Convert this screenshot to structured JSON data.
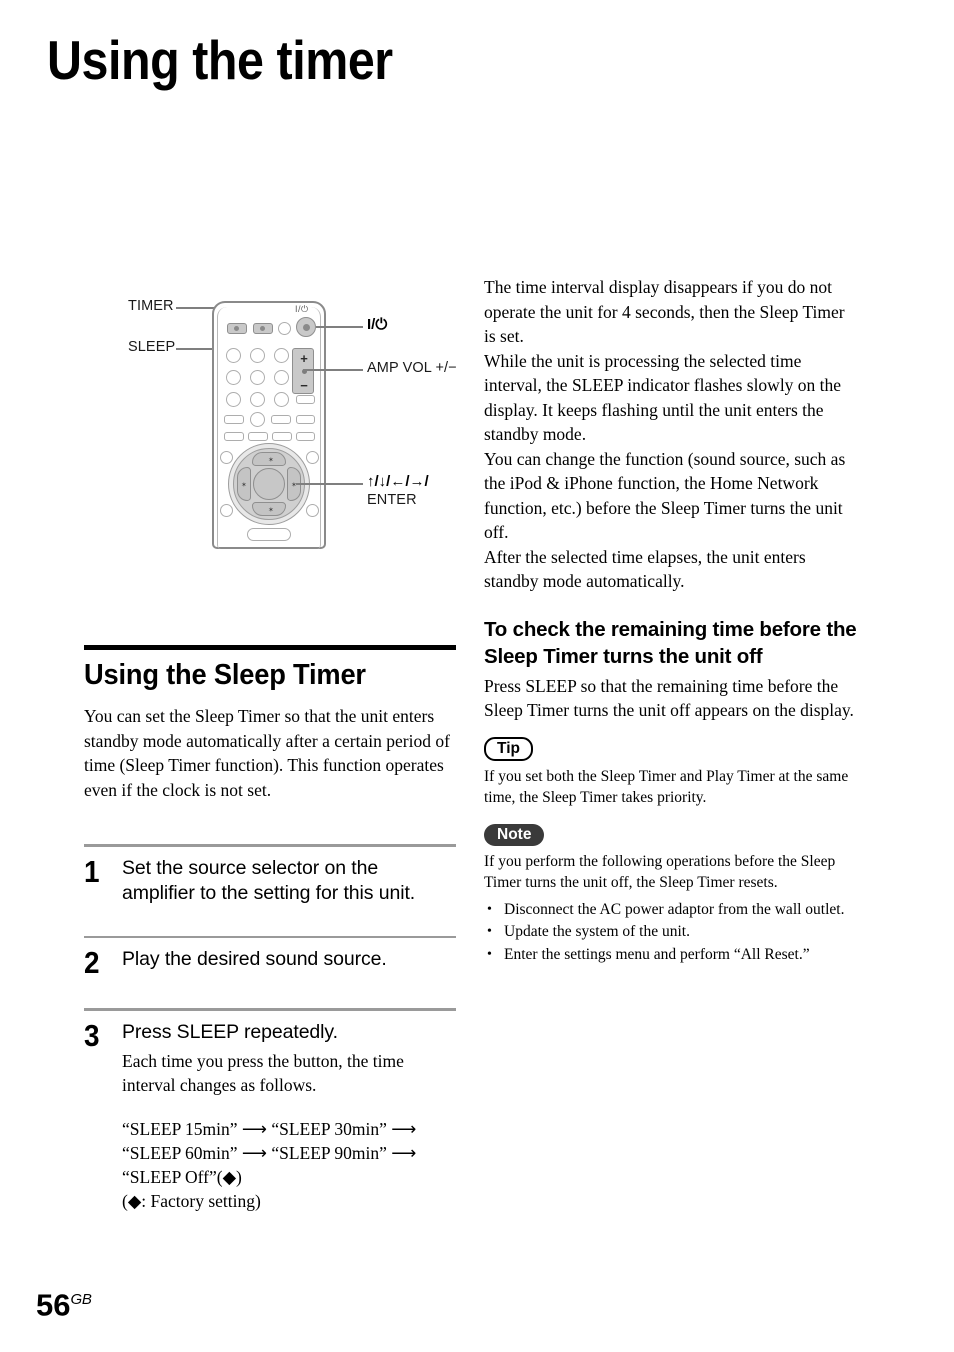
{
  "page": {
    "title": "Using the timer",
    "number": "56",
    "number_suffix": "GB"
  },
  "figure": {
    "name": "remote-control-diagram",
    "callouts": {
      "timer": "TIMER",
      "sleep": "SLEEP",
      "power": "I/⏻",
      "amp_vol": "AMP VOL +/−",
      "dpad_arrows": "↑/↓/←/→/",
      "dpad_enter": "ENTER"
    },
    "dpad_segment_glyph": "✦"
  },
  "left_column": {
    "section_heading": "Using the Sleep Timer",
    "intro": "You can set the Sleep Timer so that the unit enters standby mode automatically after a certain period of time (Sleep Timer function). This function operates even if the clock is not set.",
    "steps": [
      {
        "number": "1",
        "title": "Set the source selector on the amplifier to the setting for this unit.",
        "description": ""
      },
      {
        "number": "2",
        "title": "Play the desired sound source.",
        "description": ""
      },
      {
        "number": "3",
        "title": "Press SLEEP repeatedly.",
        "description": "Each time you press the button, the time interval changes as follows."
      }
    ],
    "sequence_line_1": "“SLEEP 15min” ⟶ “SLEEP 30min” ⟶",
    "sequence_line_2": "“SLEEP 60min” ⟶ “SLEEP 90min” ⟶",
    "sequence_line_3": "“SLEEP Off”(◆)",
    "sequence_note": "(◆: Factory setting)"
  },
  "right_column": {
    "paragraphs": [
      "The time interval display disappears if you do not operate the unit for 4 seconds, then the Sleep Timer is set.",
      "While the unit is processing the selected time interval, the SLEEP indicator flashes slowly on the display. It keeps flashing until the unit enters the standby mode.",
      "You can change the function (sound source, such as the iPod & iPhone function, the Home Network function, etc.) before the Sleep Timer turns the unit off.",
      "After the selected time elapses, the unit enters standby mode automatically."
    ],
    "sub_heading": "To check the remaining time before the Sleep Timer turns the unit off",
    "sub_body": "Press SLEEP so that the remaining time before the Sleep Timer turns the unit off appears on the display.",
    "tip": {
      "label": "Tip",
      "text": "If you set both the Sleep Timer and Play Timer at the same time, the Sleep Timer takes priority."
    },
    "note": {
      "label": "Note",
      "text": "If you perform the following operations before the Sleep Timer turns the unit off, the Sleep Timer resets.",
      "items": [
        "Disconnect the AC power adaptor from the wall outlet.",
        "Update the system of the unit.",
        "Enter the settings menu and perform “All Reset.”"
      ]
    }
  }
}
